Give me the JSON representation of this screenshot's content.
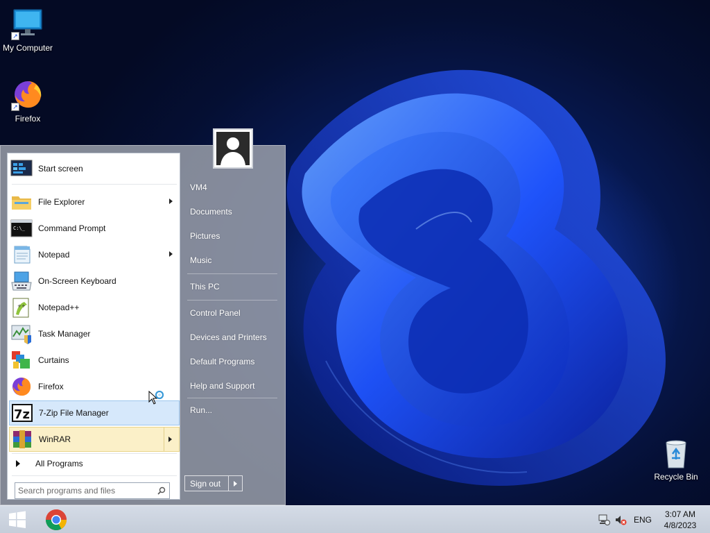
{
  "desktop": {
    "icons": [
      {
        "label": "My Computer"
      },
      {
        "label": "Firefox"
      },
      {
        "label": "Recycle Bin"
      }
    ]
  },
  "start_menu": {
    "pinned": [
      {
        "label": "Start screen",
        "icon": "start-screen-icon",
        "has_submenu": false
      },
      {
        "label": "File Explorer",
        "icon": "folder-icon",
        "has_submenu": true
      },
      {
        "label": "Command Prompt",
        "icon": "terminal-icon",
        "has_submenu": false
      },
      {
        "label": "Notepad",
        "icon": "notepad-icon",
        "has_submenu": true
      },
      {
        "label": "On-Screen Keyboard",
        "icon": "keyboard-icon",
        "has_submenu": false
      },
      {
        "label": "Notepad++",
        "icon": "notepadpp-icon",
        "has_submenu": false
      },
      {
        "label": "Task Manager",
        "icon": "task-manager-icon",
        "has_submenu": false
      },
      {
        "label": "Curtains",
        "icon": "curtains-icon",
        "has_submenu": false
      },
      {
        "label": "Firefox",
        "icon": "firefox-icon",
        "has_submenu": false
      },
      {
        "label": "7-Zip File Manager",
        "icon": "7zip-icon",
        "has_submenu": false
      },
      {
        "label": "WinRAR",
        "icon": "winrar-icon",
        "has_submenu": true
      }
    ],
    "all_programs_label": "All Programs",
    "search_placeholder": "Search programs and files",
    "right_items": [
      "VM4",
      "Documents",
      "Pictures",
      "Music",
      "This PC",
      "Control Panel",
      "Devices and Printers",
      "Default Programs",
      "Help and Support",
      "Run..."
    ],
    "sign_out_label": "Sign out"
  },
  "taskbar": {
    "language": "ENG",
    "time": "3:07 AM",
    "date": "4/8/2023"
  },
  "colors": {
    "hover_bg": "#d6e8fb",
    "highlight_bg": "#fbf0c8",
    "taskbar_bg": "#c9d1dd"
  }
}
